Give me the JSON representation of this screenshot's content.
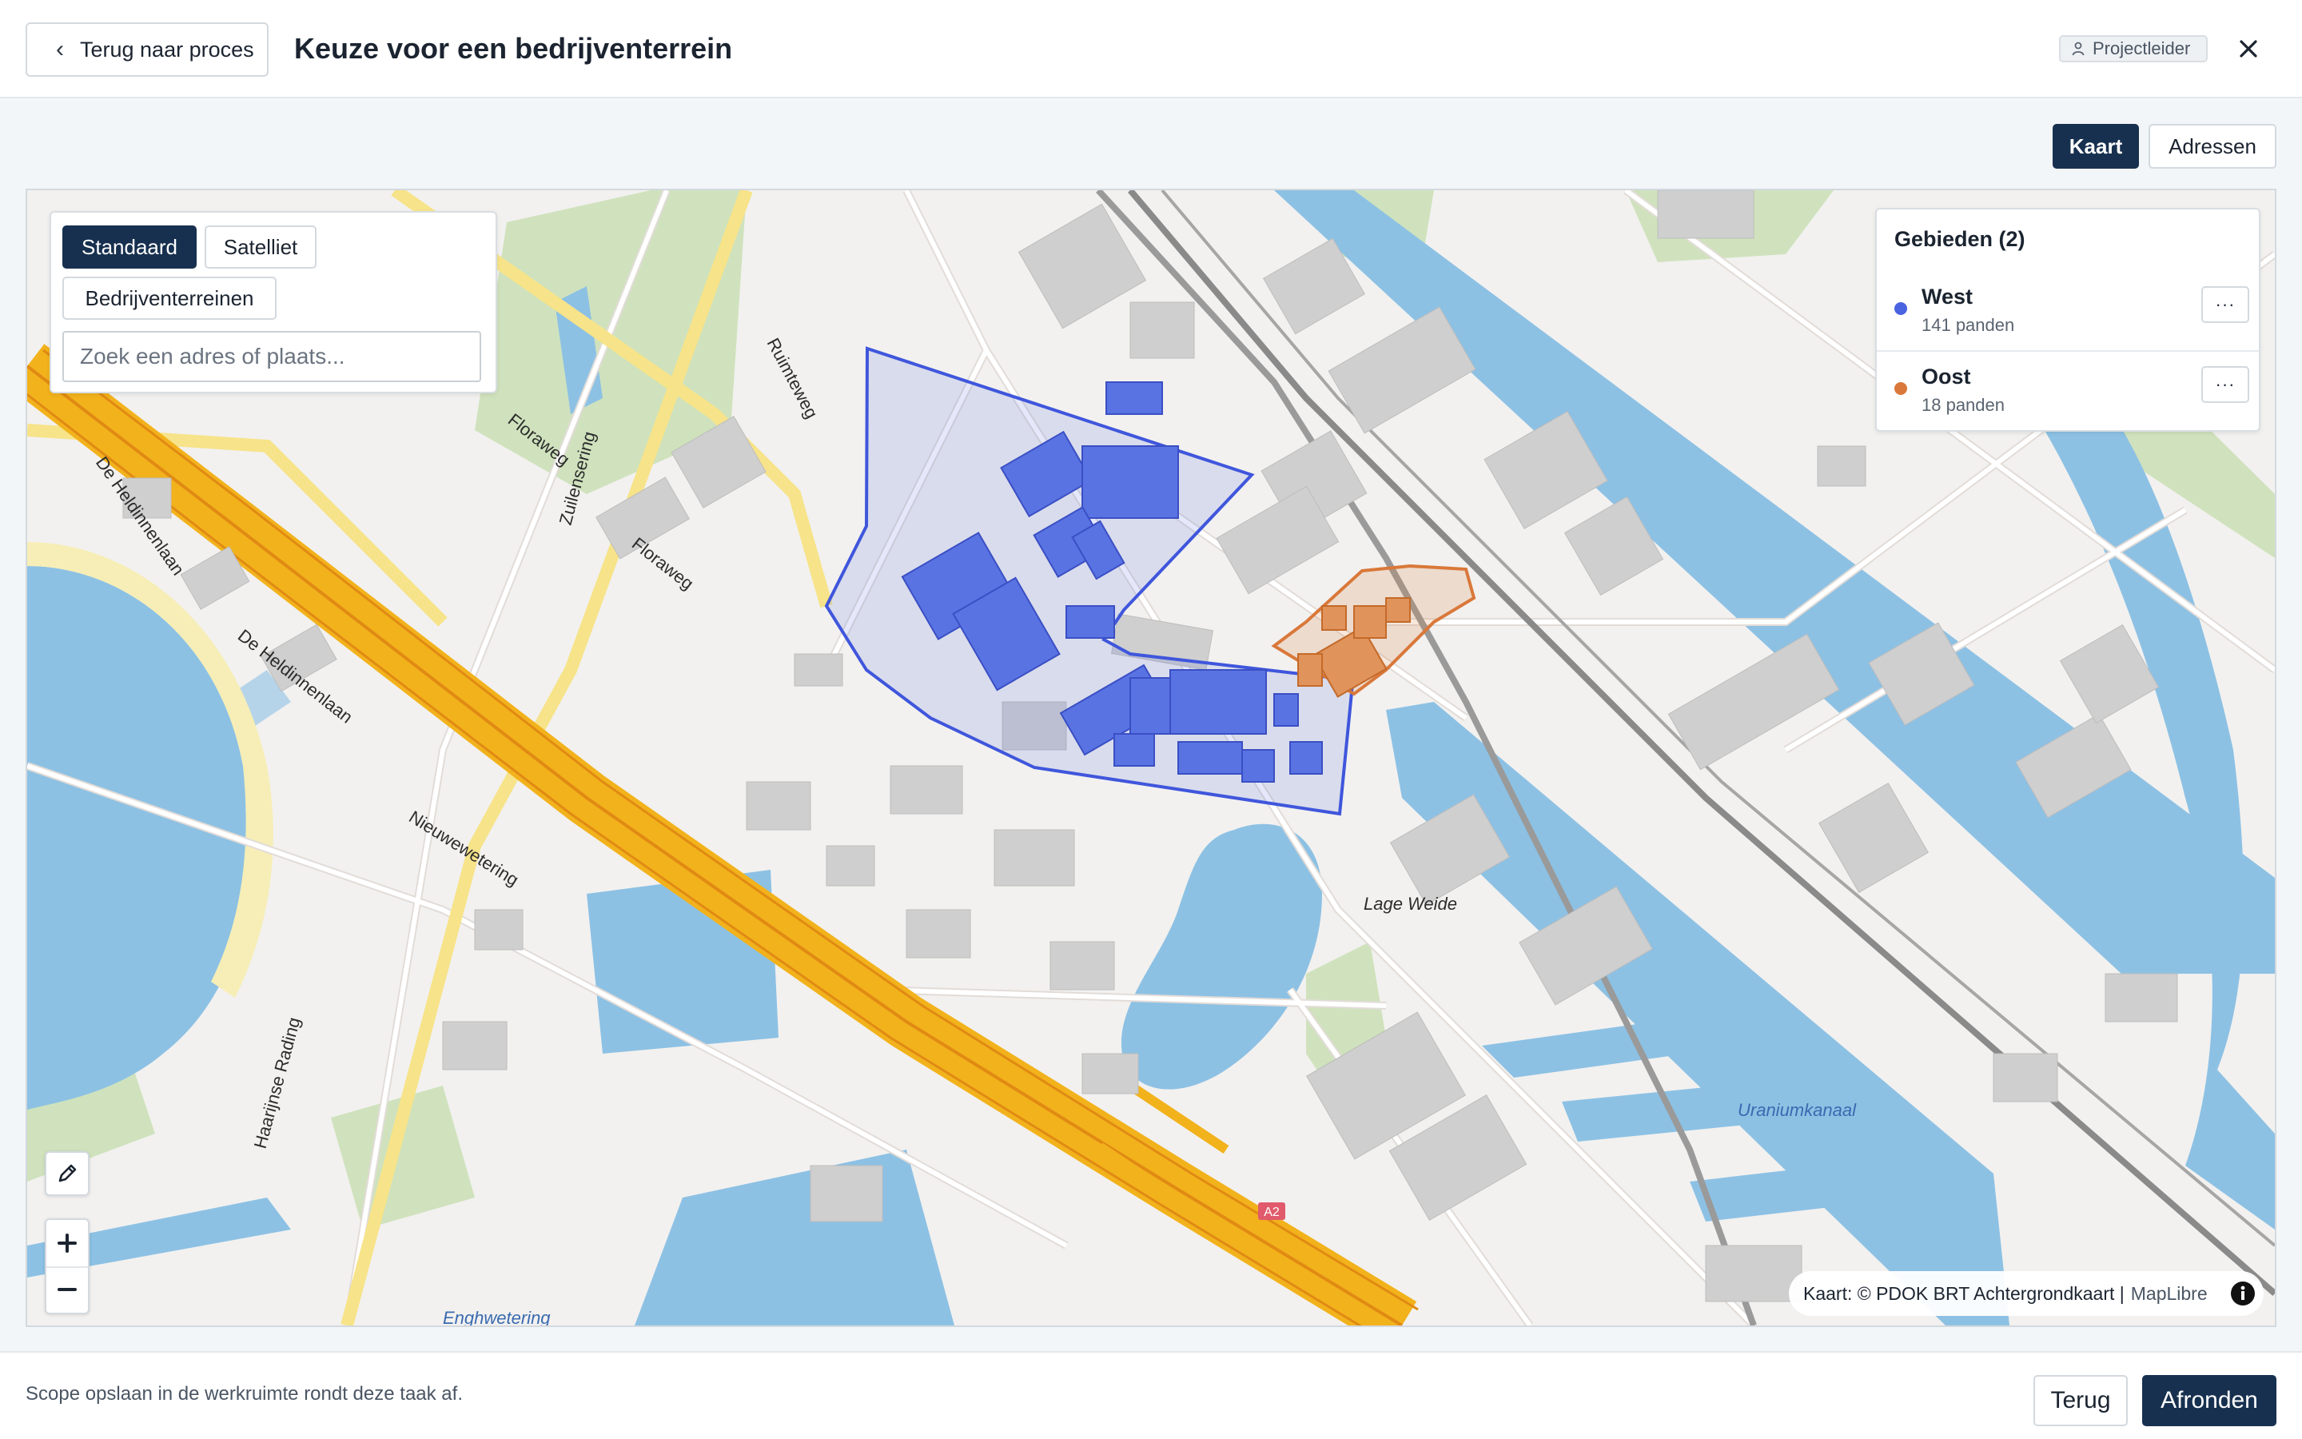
{
  "header": {
    "back_label": "Terug naar proces",
    "title": "Keuze voor een bedrijventerrein",
    "role": "Projectleider"
  },
  "view_toggle": {
    "map_label": "Kaart",
    "addresses_label": "Adressen",
    "active": "Kaart"
  },
  "map": {
    "layers": {
      "standard_label": "Standaard",
      "satellite_label": "Satelliet",
      "industrial_label": "Bedrijventerreinen",
      "active": "Standaard"
    },
    "search": {
      "value": "",
      "placeholder": "Zoek een adres of plaats..."
    },
    "areas": {
      "title": "Gebieden (2)",
      "items": [
        {
          "name": "West",
          "count": "141 panden",
          "color": "#4a63e0"
        },
        {
          "name": "Oost",
          "count": "18 panden",
          "color": "#d9783a"
        }
      ],
      "more_label": "···"
    },
    "street_labels": {
      "ruimteweg": "Ruimteweg",
      "zuilensering": "Zuilensering",
      "floraweg": "Floraweg",
      "floraweg2": "Floraweg",
      "heldinnenlaan1": "De Heldinnenlaan",
      "heldinnenlaan2": "De Heldinnenlaan",
      "nieuwewetering": "Nieuwewetering",
      "haarrijnse": "Haarijnse Rading",
      "lage_weide": "Lage Weide",
      "uraniumkanaal": "Uraniumkanaal",
      "enghwetering": "Enghwetering",
      "a2": "A2"
    },
    "attribution": {
      "text": "Kaart: © PDOK BRT Achtergrondkaart |",
      "maplibre": "MapLibre"
    },
    "colors": {
      "water": "#8dc1e4",
      "highway": "#f2b21c",
      "west_fill": "#4a63e0",
      "oost_fill": "#d9783a",
      "building": "#cfcfcf"
    }
  },
  "footer": {
    "note": "Scope opslaan in de werkruimte rondt deze taak af.",
    "back_label": "Terug",
    "finish_label": "Afronden"
  }
}
